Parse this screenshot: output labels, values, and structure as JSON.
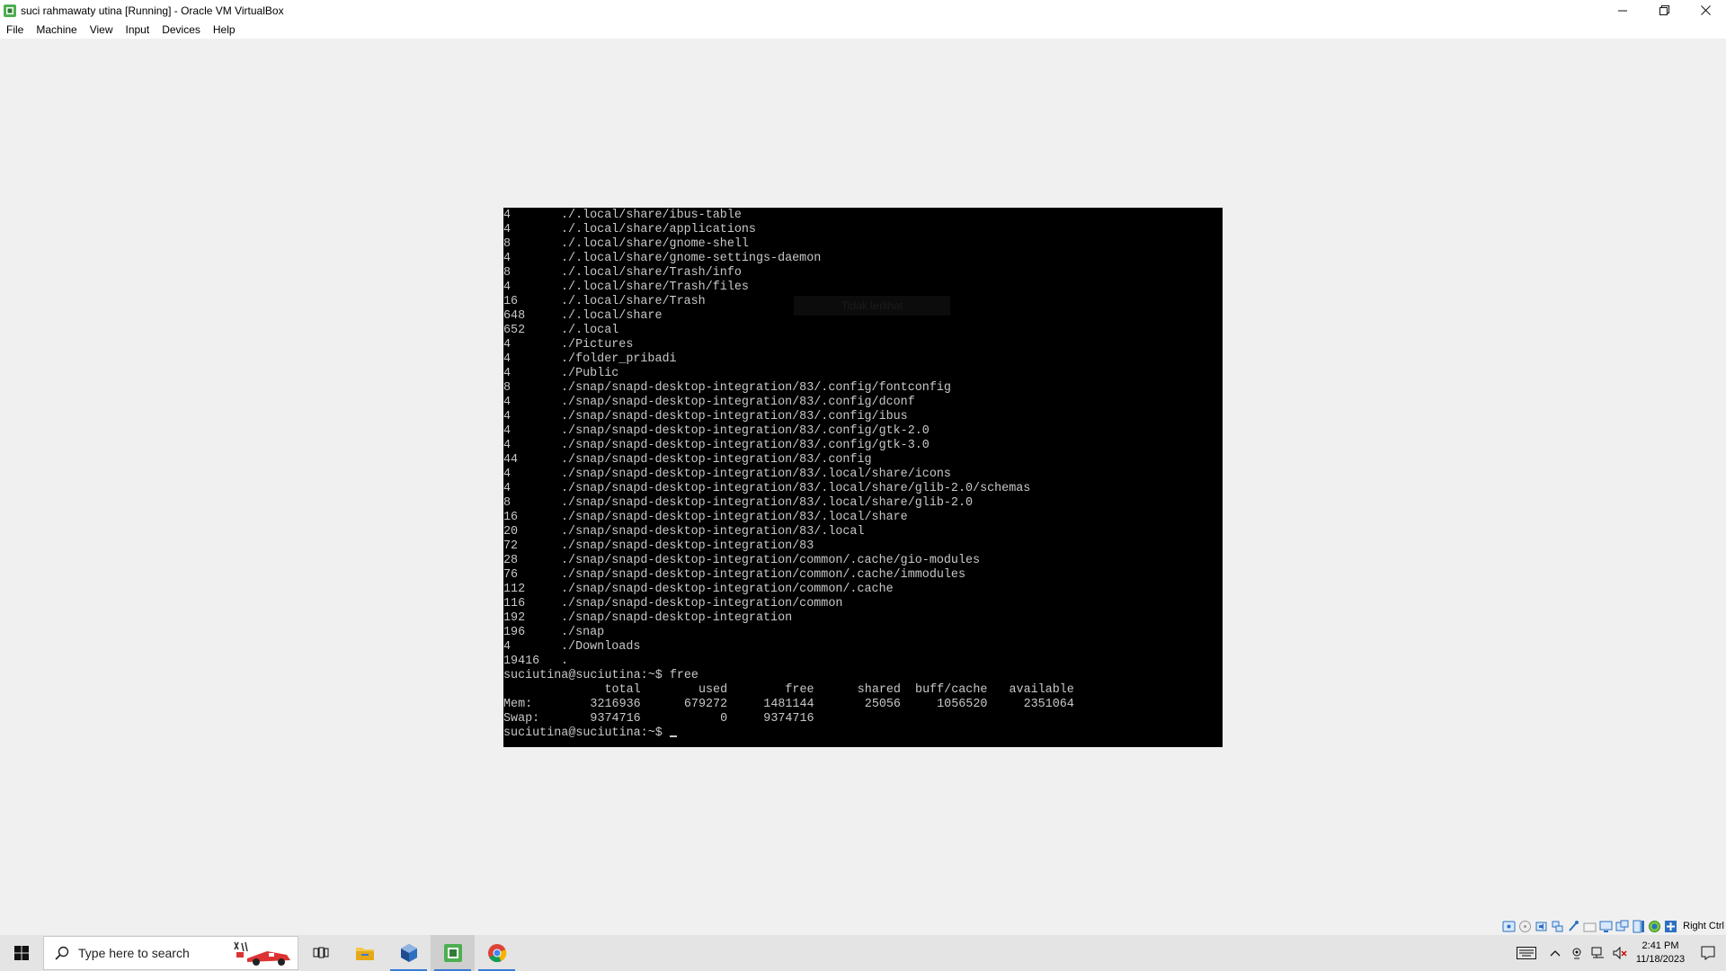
{
  "window": {
    "title": "suci rahmawaty utina [Running] - Oracle VM VirtualBox",
    "menu": [
      "File",
      "Machine",
      "View",
      "Input",
      "Devices",
      "Help"
    ]
  },
  "terminal": {
    "du_lines": [
      {
        "size": "4",
        "path": "./.local/share/ibus-table"
      },
      {
        "size": "4",
        "path": "./.local/share/applications"
      },
      {
        "size": "8",
        "path": "./.local/share/gnome-shell"
      },
      {
        "size": "4",
        "path": "./.local/share/gnome-settings-daemon"
      },
      {
        "size": "8",
        "path": "./.local/share/Trash/info"
      },
      {
        "size": "4",
        "path": "./.local/share/Trash/files"
      },
      {
        "size": "16",
        "path": "./.local/share/Trash"
      },
      {
        "size": "648",
        "path": "./.local/share"
      },
      {
        "size": "652",
        "path": "./.local"
      },
      {
        "size": "4",
        "path": "./Pictures"
      },
      {
        "size": "4",
        "path": "./folder_pribadi"
      },
      {
        "size": "4",
        "path": "./Public"
      },
      {
        "size": "8",
        "path": "./snap/snapd-desktop-integration/83/.config/fontconfig"
      },
      {
        "size": "4",
        "path": "./snap/snapd-desktop-integration/83/.config/dconf"
      },
      {
        "size": "4",
        "path": "./snap/snapd-desktop-integration/83/.config/ibus"
      },
      {
        "size": "4",
        "path": "./snap/snapd-desktop-integration/83/.config/gtk-2.0"
      },
      {
        "size": "4",
        "path": "./snap/snapd-desktop-integration/83/.config/gtk-3.0"
      },
      {
        "size": "44",
        "path": "./snap/snapd-desktop-integration/83/.config"
      },
      {
        "size": "4",
        "path": "./snap/snapd-desktop-integration/83/.local/share/icons"
      },
      {
        "size": "4",
        "path": "./snap/snapd-desktop-integration/83/.local/share/glib-2.0/schemas"
      },
      {
        "size": "8",
        "path": "./snap/snapd-desktop-integration/83/.local/share/glib-2.0"
      },
      {
        "size": "16",
        "path": "./snap/snapd-desktop-integration/83/.local/share"
      },
      {
        "size": "20",
        "path": "./snap/snapd-desktop-integration/83/.local"
      },
      {
        "size": "72",
        "path": "./snap/snapd-desktop-integration/83"
      },
      {
        "size": "28",
        "path": "./snap/snapd-desktop-integration/common/.cache/gio-modules"
      },
      {
        "size": "76",
        "path": "./snap/snapd-desktop-integration/common/.cache/immodules"
      },
      {
        "size": "112",
        "path": "./snap/snapd-desktop-integration/common/.cache"
      },
      {
        "size": "116",
        "path": "./snap/snapd-desktop-integration/common"
      },
      {
        "size": "192",
        "path": "./snap/snapd-desktop-integration"
      },
      {
        "size": "196",
        "path": "./snap"
      },
      {
        "size": "4",
        "path": "./Downloads"
      },
      {
        "size": "19416",
        "path": "."
      }
    ],
    "prompt_free": "suciutina@suciutina:~$ free",
    "free_header": "              total        used        free      shared  buff/cache   available",
    "free_mem": "Mem:        3216936      679272     1481144       25056     1056520     2351064",
    "free_swap": "Swap:       9374716           0     9374716",
    "prompt_final": "suciutina@suciutina:~$ ",
    "overlay_text": "Tidak terlihat"
  },
  "statusbar": {
    "host_key": "Right Ctrl"
  },
  "taskbar": {
    "search_placeholder": "Type here to search",
    "clock_time": "2:41 PM",
    "clock_date": "11/18/2023"
  },
  "colors": {
    "accent": "#3a7bd5",
    "terminal_bg": "#000000",
    "terminal_fg": "#c8c8c8"
  }
}
